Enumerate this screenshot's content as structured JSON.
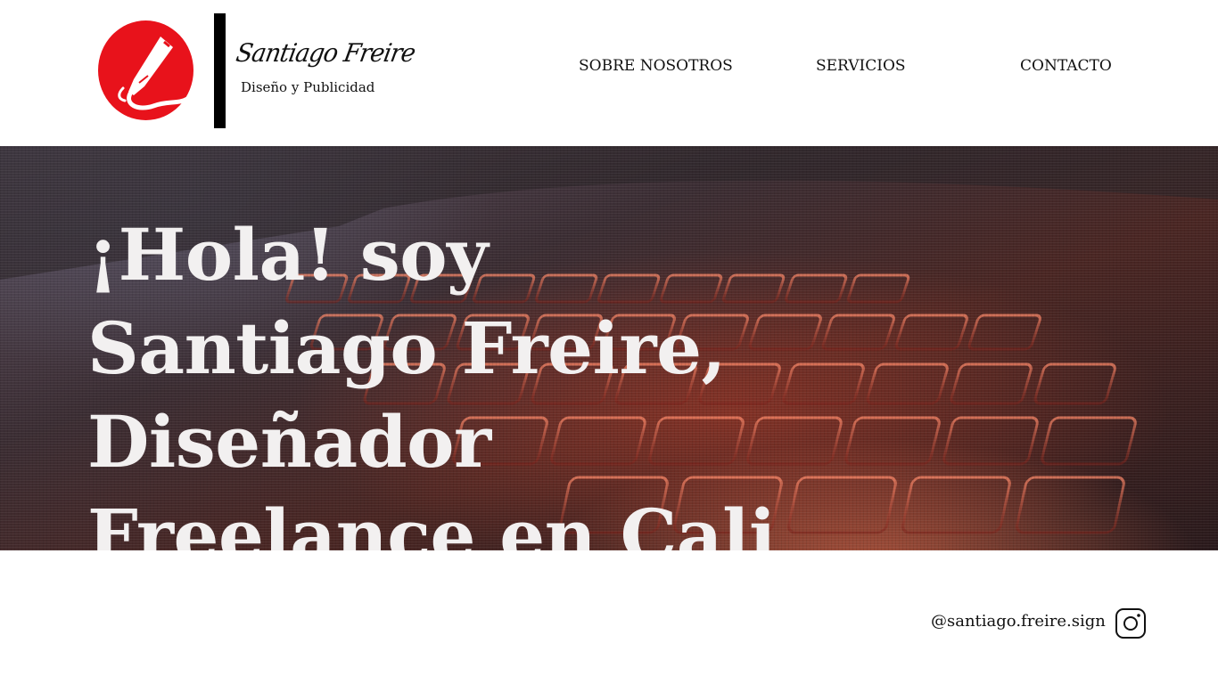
{
  "header": {
    "logo": {
      "signature": "Santiago Freire",
      "tagline": "Diseño y Publicidad",
      "brand_color": "#e8121b",
      "icon": "pen-nib-icon"
    },
    "nav": [
      {
        "label": "SOBRE NOSOTROS"
      },
      {
        "label": "SERVICIOS"
      },
      {
        "label": "CONTACTO"
      }
    ]
  },
  "hero": {
    "title": "¡Hola! soy Santiago Freire, Diseñador Freelance en Cali",
    "background": "laptop-keyboard-photo"
  },
  "footer": {
    "instagram_handle": "@santiago.freire.sign",
    "icon": "instagram-icon"
  }
}
